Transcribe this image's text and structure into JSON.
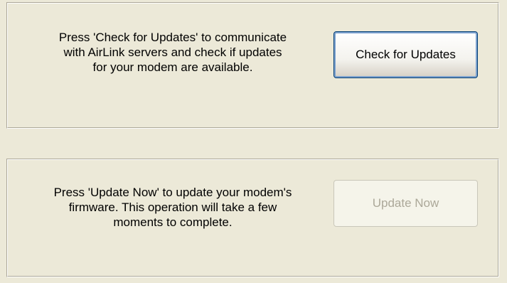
{
  "check_section": {
    "description_lines": [
      "Press 'Check for Updates' to communicate",
      "with AirLink servers and check if updates",
      "for your modem are available."
    ],
    "button_label": "Check for Updates"
  },
  "update_section": {
    "description_lines": [
      "Press 'Update Now' to update your modem's",
      "firmware. This operation will take a few",
      "moments to complete."
    ],
    "button_label": "Update Now",
    "button_enabled": false
  },
  "colors": {
    "background": "#ECE9D8",
    "button_border_active": "#003C74",
    "disabled_text": "#ACA899"
  }
}
